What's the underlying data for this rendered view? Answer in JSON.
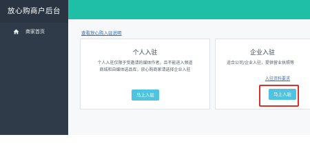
{
  "app": {
    "title": "放心购商户后台",
    "colors": {
      "sidebar": "#2f3b48",
      "topbar": "#1ebfa6",
      "button": "#4fc3e0",
      "highlight": "#d9302a"
    }
  },
  "sidebar": {
    "items": [
      {
        "label": "商家首页",
        "icon": "home-icon"
      }
    ]
  },
  "main": {
    "info_link": "查看放心购入驻说明",
    "cards": [
      {
        "title": "个人入驻",
        "description_lines": [
          "个人入驻仅限于受邀请的媒体作者，且不能进入频道",
          "商城和自媒体选品库，放心购商家请选择企业入驻"
        ],
        "button": "马上入驻"
      },
      {
        "title": "企业入驻",
        "description_lines": [
          "适合公司/企业入驻，提供营业执照等"
        ],
        "requirements_link": "入驻资料要求",
        "button": "马上入驻"
      }
    ]
  }
}
